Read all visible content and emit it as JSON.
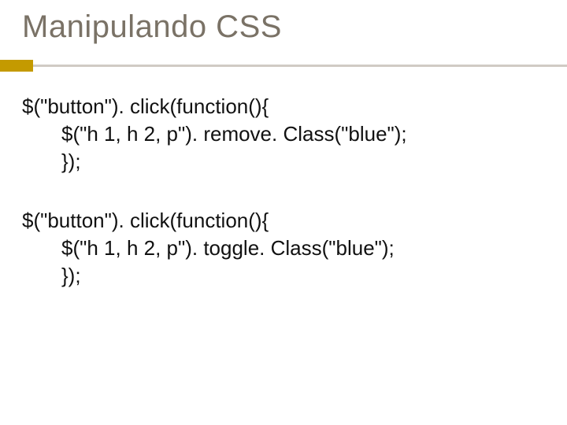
{
  "title": "Manipulando CSS",
  "code1": {
    "l1": "$(\"button\"). click(function(){",
    "l2": "$(\"h 1, h 2, p\"). remove. Class(\"blue\");",
    "l3": "});"
  },
  "code2": {
    "l1": "$(\"button\"). click(function(){",
    "l2": "$(\"h 1, h 2, p\"). toggle. Class(\"blue\");",
    "l3": "});"
  }
}
